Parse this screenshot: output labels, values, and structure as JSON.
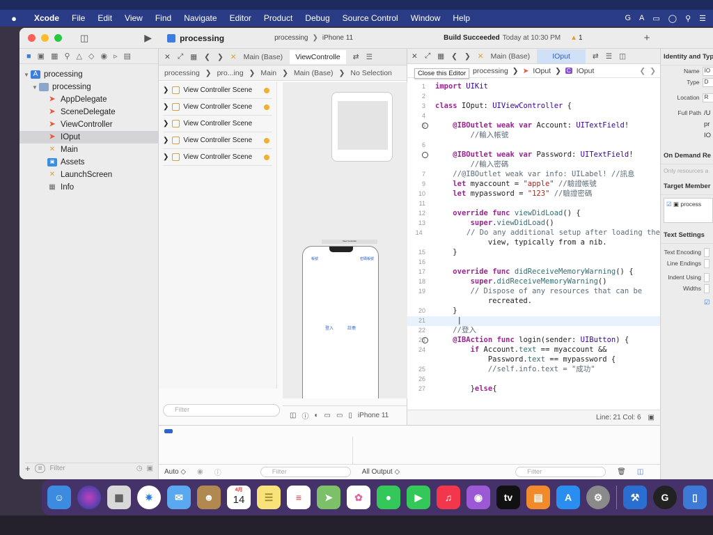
{
  "menubar": {
    "apple": "",
    "app": "Xcode",
    "items": [
      "File",
      "Edit",
      "View",
      "Find",
      "Navigate",
      "Editor",
      "Product",
      "Debug",
      "Source Control",
      "Window",
      "Help"
    ]
  },
  "toolbar": {
    "project": "processing",
    "scheme": "processing",
    "device": "iPhone 11",
    "build_status_bold": "Build Succeeded",
    "build_status_time": "Today at 10:30 PM",
    "warning_count": "1",
    "add": "+"
  },
  "navigator": {
    "project": "processing",
    "group": "processing",
    "files": [
      {
        "name": "AppDelegate",
        "type": "swift"
      },
      {
        "name": "SceneDelegate",
        "type": "swift"
      },
      {
        "name": "ViewController",
        "type": "swift"
      },
      {
        "name": "IOput",
        "type": "swift"
      },
      {
        "name": "Main",
        "type": "storyboard"
      },
      {
        "name": "Assets",
        "type": "assets"
      },
      {
        "name": "LaunchScreen",
        "type": "storyboard"
      },
      {
        "name": "Info",
        "type": "plist"
      }
    ],
    "selected": "IOput",
    "filter_placeholder": "Filter"
  },
  "ib_editor": {
    "tab_main_base": "Main (Base)",
    "tab_view_controller": "ViewControlle",
    "jump": [
      "processing",
      "pro...ing",
      "Main",
      "Main (Base)",
      "No Selection"
    ],
    "scenes": [
      "View Controller Scene",
      "View Controller Scene",
      "View Controller Scene",
      "View Controller Scene",
      "View Controller Scene"
    ],
    "filter_placeholder": "Filter",
    "device_label": "iPhone 11",
    "phone_top_left": "帳號",
    "phone_top_right": "密碼帳號",
    "phone_login": "登入",
    "phone_register": "註冊",
    "scene_title": "View Controller"
  },
  "code_editor": {
    "tab_main_base": "Main (Base)",
    "tab_active": "IOput",
    "jump": [
      "processing",
      "IOput",
      "IOput"
    ],
    "tooltip": "Close this Editor",
    "status": "Line: 21  Col: 6",
    "lines": [
      {
        "n": "1",
        "t": "import UIKit"
      },
      {
        "n": "2",
        "t": ""
      },
      {
        "n": "3",
        "t": "class IOput: UIViewController {"
      },
      {
        "n": "4",
        "t": ""
      },
      {
        "n": "5",
        "t": "    @IBOutlet weak var Account: UITextField!"
      },
      {
        "n": "",
        "t": "        //輸入帳號"
      },
      {
        "n": "6",
        "t": ""
      },
      {
        "n": "",
        "t": "    @IBOutlet weak var Password: UITextField!"
      },
      {
        "n": "",
        "t": "        //輸入密碼"
      },
      {
        "n": "7",
        "t": "    //@IBOutlet weak var info: UILabel! //訊息"
      },
      {
        "n": "9",
        "t": "    let myaccount = \"apple\" //驗證帳號"
      },
      {
        "n": "10",
        "t": "    let mypassword = \"123\" //驗證密碼"
      },
      {
        "n": "11",
        "t": ""
      },
      {
        "n": "12",
        "t": "    override func viewDidLoad() {"
      },
      {
        "n": "13",
        "t": "        super.viewDidLoad()"
      },
      {
        "n": "14",
        "t": "        // Do any additional setup after loading the"
      },
      {
        "n": "",
        "t": "            view, typically from a nib."
      },
      {
        "n": "15",
        "t": "    }"
      },
      {
        "n": "16",
        "t": ""
      },
      {
        "n": "17",
        "t": "    override func didReceiveMemoryWarning() {"
      },
      {
        "n": "18",
        "t": "        super.didReceiveMemoryWarning()"
      },
      {
        "n": "19",
        "t": "        // Dispose of any resources that can be"
      },
      {
        "n": "",
        "t": "            recreated."
      },
      {
        "n": "20",
        "t": "    }"
      },
      {
        "n": "21",
        "t": "     |"
      },
      {
        "n": "22",
        "t": "    //登入"
      },
      {
        "n": "23",
        "t": "    @IBAction func login(sender: UIButton) {"
      },
      {
        "n": "24",
        "t": "        if Account.text == myaccount &&"
      },
      {
        "n": "",
        "t": "            Password.text == mypassword {"
      },
      {
        "n": "25",
        "t": "            //self.info.text = \"成功\""
      },
      {
        "n": "26",
        "t": ""
      },
      {
        "n": "27",
        "t": "        }else{"
      }
    ]
  },
  "inspector": {
    "identity_title": "Identity and Typ",
    "name_label": "Name",
    "name_value": "IO",
    "type_label": "Type",
    "type_value": "D",
    "location_label": "Location",
    "location_value": "R",
    "fullpath_label": "Full Path",
    "fullpath_value": "/U",
    "fullpath_line2": "pr",
    "fullpath_line3": "IO",
    "on_demand_title": "On Demand Re",
    "only_resources": "Only resources a",
    "target_title": "Target Member",
    "target_item": "process",
    "text_settings_title": "Text Settings",
    "text_encoding": "Text Encoding",
    "line_endings": "Line Endings",
    "indent_using": "Indent Using",
    "widths": "Widths"
  },
  "debug": {
    "auto_label": "Auto ◇",
    "filter_placeholder": "Filter",
    "output_label": "All Output ◇",
    "filter2_placeholder": "Filter"
  },
  "dock": {
    "calendar_month": "4月",
    "calendar_day": "14",
    "tv_label": "tv",
    "apps": [
      "Finder",
      "Siri",
      "Launchpad",
      "Safari",
      "Mail",
      "Contacts",
      "Calendar",
      "Notes",
      "Reminders",
      "Maps",
      "Photos",
      "Messages",
      "FaceTime",
      "Music",
      "Podcasts",
      "TV",
      "Books",
      "App Store",
      "System Preferences",
      "Xcode",
      "Logi Options",
      "Simulator"
    ]
  }
}
